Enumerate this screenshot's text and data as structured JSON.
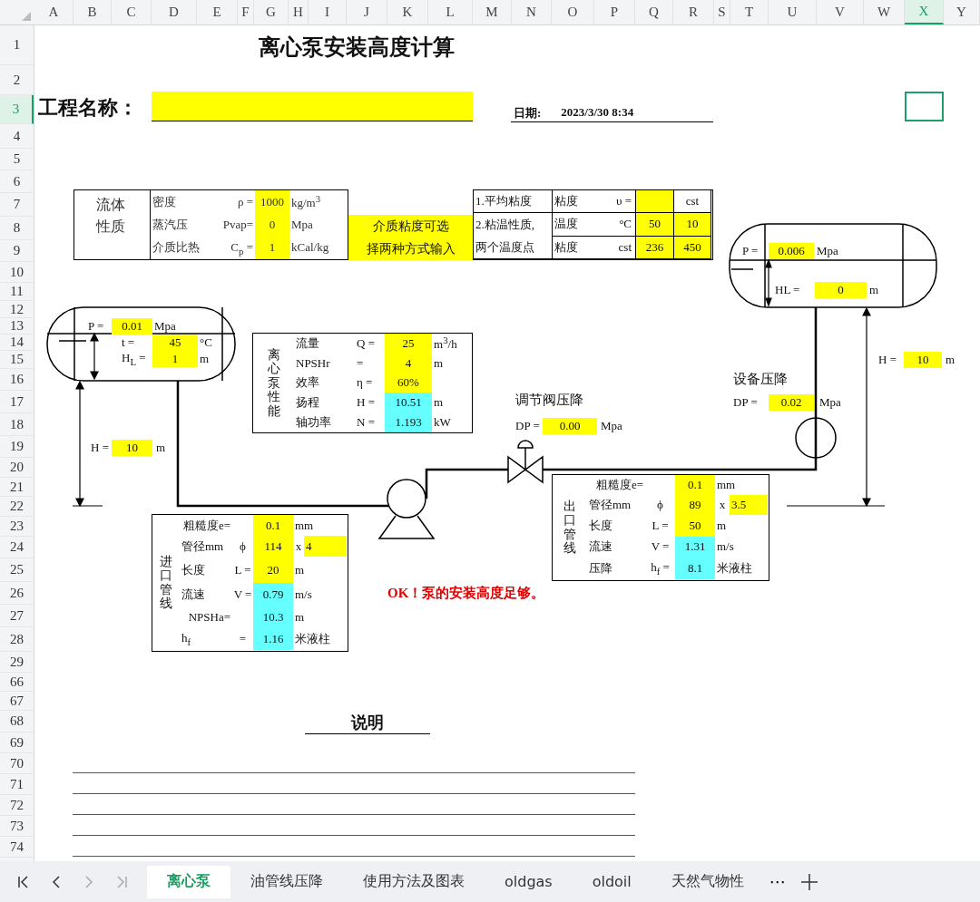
{
  "column_headers": [
    {
      "label": "A",
      "selected": false
    },
    {
      "label": "B",
      "selected": false
    },
    {
      "label": "C",
      "selected": false
    },
    {
      "label": "D",
      "selected": false
    },
    {
      "label": "E",
      "selected": false
    },
    {
      "label": "F",
      "selected": false
    },
    {
      "label": "G",
      "selected": false
    },
    {
      "label": "H",
      "selected": false
    },
    {
      "label": "I",
      "selected": false
    },
    {
      "label": "J",
      "selected": false
    },
    {
      "label": "K",
      "selected": false
    },
    {
      "label": "L",
      "selected": false
    },
    {
      "label": "M",
      "selected": false
    },
    {
      "label": "N",
      "selected": false
    },
    {
      "label": "O",
      "selected": false
    },
    {
      "label": "P",
      "selected": false
    },
    {
      "label": "Q",
      "selected": false
    },
    {
      "label": "R",
      "selected": false
    },
    {
      "label": "S",
      "selected": false
    },
    {
      "label": "T",
      "selected": false
    },
    {
      "label": "U",
      "selected": false
    },
    {
      "label": "V",
      "selected": false
    },
    {
      "label": "W",
      "selected": false
    },
    {
      "label": "X",
      "selected": true
    },
    {
      "label": "Y",
      "selected": false
    }
  ],
  "row_headers": [
    {
      "label": "1",
      "selected": false
    },
    {
      "label": "2",
      "selected": false
    },
    {
      "label": "3",
      "selected": true
    },
    {
      "label": "4",
      "selected": false
    },
    {
      "label": "5",
      "selected": false
    },
    {
      "label": "6",
      "selected": false
    },
    {
      "label": "7",
      "selected": false
    },
    {
      "label": "8",
      "selected": false
    },
    {
      "label": "9",
      "selected": false
    },
    {
      "label": "10",
      "selected": false
    },
    {
      "label": "11",
      "selected": false
    },
    {
      "label": "12",
      "selected": false
    },
    {
      "label": "13",
      "selected": false
    },
    {
      "label": "14",
      "selected": false
    },
    {
      "label": "15",
      "selected": false
    },
    {
      "label": "16",
      "selected": false
    },
    {
      "label": "17",
      "selected": false
    },
    {
      "label": "18",
      "selected": false
    },
    {
      "label": "19",
      "selected": false
    },
    {
      "label": "20",
      "selected": false
    },
    {
      "label": "21",
      "selected": false
    },
    {
      "label": "22",
      "selected": false
    },
    {
      "label": "23",
      "selected": false
    },
    {
      "label": "24",
      "selected": false
    },
    {
      "label": "25",
      "selected": false
    },
    {
      "label": "26",
      "selected": false
    },
    {
      "label": "27",
      "selected": false
    },
    {
      "label": "28",
      "selected": false
    },
    {
      "label": "29",
      "selected": false
    },
    {
      "label": "66",
      "selected": false
    },
    {
      "label": "67",
      "selected": false
    },
    {
      "label": "68",
      "selected": false
    },
    {
      "label": "69",
      "selected": false
    },
    {
      "label": "70",
      "selected": false
    },
    {
      "label": "71",
      "selected": false
    },
    {
      "label": "72",
      "selected": false
    },
    {
      "label": "73",
      "selected": false
    },
    {
      "label": "74",
      "selected": false
    }
  ],
  "title": "离心泵安装高度计算",
  "project": {
    "label": "工程名称："
  },
  "date": {
    "label": "日期:",
    "value": "2023/3/30 8:34"
  },
  "fluid_properties": {
    "heading": "流体性质",
    "rows": [
      {
        "label": "密度",
        "symbol": "ρ =",
        "value": "1000",
        "unit": "kg/m$^{3}$"
      },
      {
        "label": "蒸汽压",
        "symbol": "Pvap=",
        "value": "0",
        "unit": "Mpa"
      },
      {
        "label": "介质比热",
        "symbol": "C$_{p}$ =",
        "value": "1",
        "unit": "kCal/kg"
      }
    ]
  },
  "viscosity_hint": [
    "介质粘度可选",
    "择两种方式输入"
  ],
  "viscosity": {
    "rows": [
      {
        "method": "1.平均粘度",
        "label": "粘度",
        "symbol": "υ =",
        "unit": "cst"
      },
      {
        "method": "2.粘温性质,",
        "label": "温度",
        "symbol": "°C",
        "values": [
          "50",
          "10"
        ]
      },
      {
        "method": "两个温度点",
        "label": "粘度",
        "symbol": "cst",
        "values": [
          "236",
          "450"
        ]
      }
    ]
  },
  "suction_tank": {
    "fields": [
      {
        "label": "P =",
        "value": "0.01",
        "unit": "Mpa"
      },
      {
        "label": "t =",
        "value": "45",
        "unit": "°C"
      },
      {
        "label": "H$_{L}$ =",
        "value": "1",
        "unit": "m"
      }
    ],
    "height": {
      "label": "H =",
      "value": "10",
      "unit": "m"
    }
  },
  "discharge_tank": {
    "fields": [
      {
        "label": "P =",
        "value": "0.006",
        "unit": "Mpa"
      },
      {
        "label": "HL =",
        "value": "0",
        "unit": "m"
      }
    ],
    "height": {
      "label": "H =",
      "value": "10",
      "unit": "m"
    }
  },
  "pump_performance": {
    "heading": "离心泵性能",
    "rows": [
      {
        "label": "流量",
        "symbol": "Q =",
        "value": "25",
        "unit": "m$^{3}$/h",
        "calculated": false
      },
      {
        "label": "NPSHr",
        "symbol": "=",
        "value": "4",
        "unit": "m",
        "calculated": false
      },
      {
        "label": "效率",
        "symbol": "η =",
        "value": "60%",
        "calculated": false
      },
      {
        "label": "扬程",
        "symbol": "H =",
        "value": "10.51",
        "unit": "m",
        "calculated": true
      },
      {
        "label": "轴功率",
        "symbol": "N =",
        "value": "1.193",
        "unit": "kW",
        "calculated": true
      }
    ]
  },
  "control_valve": {
    "label": "调节阀压降",
    "symbol": "DP =",
    "value": "0.00",
    "unit": "Mpa"
  },
  "equipment": {
    "label": "设备压降",
    "symbol": "DP =",
    "value": "0.02",
    "unit": "Mpa"
  },
  "inlet_pipe": {
    "heading": "进口管线",
    "rows": [
      {
        "label": "粗糙度e=",
        "value": "0.1",
        "unit": "mm",
        "calculated": false
      },
      {
        "label": "管径mm",
        "symbol": "ϕ",
        "value": "114",
        "times": "x",
        "value2": "4",
        "calculated": false
      },
      {
        "label": "长度",
        "symbol": "L =",
        "value": "20",
        "unit": "m",
        "calculated": false
      },
      {
        "label": "流速",
        "symbol": "V =",
        "value": "0.79",
        "unit": "m/s",
        "calculated": true
      },
      {
        "label": "NPSHa=",
        "value": "10.3",
        "unit": "m",
        "calculated": true
      },
      {
        "label": "h$_{f}$",
        "symbol": "=",
        "value": "1.16",
        "unit": "米液柱",
        "calculated": true
      }
    ]
  },
  "outlet_pipe": {
    "heading": "出口管线",
    "rows": [
      {
        "label": "粗糙度e=",
        "value": "0.1",
        "unit": "mm",
        "calculated": false
      },
      {
        "label": "管径mm",
        "symbol": "ϕ",
        "value": "89",
        "times": "x",
        "value2": "3.5",
        "calculated": false
      },
      {
        "label": "长度",
        "symbol": "L =",
        "value": "50",
        "unit": "m",
        "calculated": false
      },
      {
        "label": "流速",
        "symbol": "V =",
        "value": "1.31",
        "unit": "m/s",
        "calculated": true
      },
      {
        "label": "压降",
        "symbol": "h$_{f}$ =",
        "value": "8.1",
        "unit": "米液柱",
        "calculated": true
      }
    ]
  },
  "status": "OK！泵的安装高度足够。",
  "notes": {
    "heading": "说明"
  },
  "sheet_tabs": [
    {
      "label": "离心泵",
      "selected": true
    },
    {
      "label": "油管线压降",
      "selected": false
    },
    {
      "label": "使用方法及图表",
      "selected": false
    },
    {
      "label": "oldgas",
      "selected": false
    },
    {
      "label": "oldoil",
      "selected": false
    },
    {
      "label": "天然气物性",
      "selected": false
    }
  ],
  "more_tabs": "⋯"
}
